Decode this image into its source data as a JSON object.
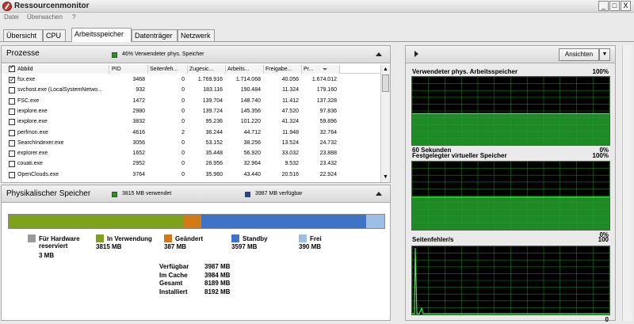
{
  "window": {
    "title": "Ressourcenmonitor",
    "controls": [
      "_",
      "□",
      "X"
    ]
  },
  "menu": [
    "Datei",
    "Überwachen",
    "?"
  ],
  "tabs": [
    {
      "label": "Übersicht",
      "active": false
    },
    {
      "label": "CPU",
      "active": false
    },
    {
      "label": "Arbeitsspeicher",
      "active": true
    },
    {
      "label": "Datenträger",
      "active": false
    },
    {
      "label": "Netzwerk",
      "active": false
    }
  ],
  "processes": {
    "title": "Prozesse",
    "usage_label": "46% Verwendeter phys. Speicher",
    "usage_color": "#1a9a1a",
    "columns": [
      "Abbild",
      "PID",
      "Seitenfeh...",
      "Zugesic...",
      "Arbeits...",
      "Freigabe...",
      "Pr..."
    ],
    "rows": [
      {
        "checked": true,
        "name": "fsx.exe",
        "pid": "3468",
        "faults": "0",
        "commit": "1.769.916",
        "working": "1.714.068",
        "shareable": "40.056",
        "private": "1.674.012"
      },
      {
        "checked": false,
        "name": "svchost.exe (LocalSystemNetwo...",
        "pid": "932",
        "faults": "0",
        "commit": "183.116",
        "working": "190.484",
        "shareable": "11.324",
        "private": "179.160"
      },
      {
        "checked": false,
        "name": "FSC.exe",
        "pid": "1472",
        "faults": "0",
        "commit": "139.704",
        "working": "148.740",
        "shareable": "11.412",
        "private": "137.328"
      },
      {
        "checked": false,
        "name": "iexplore.exe",
        "pid": "2980",
        "faults": "0",
        "commit": "139.724",
        "working": "145.356",
        "shareable": "47.520",
        "private": "97.836"
      },
      {
        "checked": false,
        "name": "iexplore.exe",
        "pid": "3832",
        "faults": "0",
        "commit": "95.236",
        "working": "101.220",
        "shareable": "41.324",
        "private": "59.896"
      },
      {
        "checked": false,
        "name": "perfmon.exe",
        "pid": "4616",
        "faults": "2",
        "commit": "36.244",
        "working": "44.712",
        "shareable": "11.948",
        "private": "32.764"
      },
      {
        "checked": false,
        "name": "SearchIndexer.exe",
        "pid": "3056",
        "faults": "0",
        "commit": "53.152",
        "working": "38.256",
        "shareable": "13.524",
        "private": "24.732"
      },
      {
        "checked": false,
        "name": "explorer.exe",
        "pid": "1652",
        "faults": "0",
        "commit": "35.448",
        "working": "56.920",
        "shareable": "33.032",
        "private": "23.888"
      },
      {
        "checked": false,
        "name": "couati.exe",
        "pid": "2952",
        "faults": "0",
        "commit": "26.956",
        "working": "32.964",
        "shareable": "9.532",
        "private": "23.432"
      },
      {
        "checked": false,
        "name": "OpenClouds.exe",
        "pid": "3764",
        "faults": "0",
        "commit": "35.960",
        "working": "43.440",
        "shareable": "20.516",
        "private": "22.924"
      }
    ]
  },
  "physical": {
    "title": "Physikalischer Speicher",
    "used_label": "3815 MB verwendet",
    "used_color": "#1a9a1a",
    "avail_label": "3987 MB verfügbar",
    "avail_color": "#1e3fb0",
    "bar": [
      {
        "mb": 3815,
        "color": "#7fa21c"
      },
      {
        "mb": 387,
        "color": "#d27b16"
      },
      {
        "mb": 3597,
        "color": "#3d74c7"
      },
      {
        "mb": 390,
        "color": "#9dbee6"
      }
    ],
    "legend": [
      {
        "label": "Für Hardware reserviert",
        "value": "3 MB",
        "color": "#9a9a9a"
      },
      {
        "label": "In Verwendung",
        "value": "3815 MB",
        "color": "#7fa21c"
      },
      {
        "label": "Geändert",
        "value": "387 MB",
        "color": "#d27b16"
      },
      {
        "label": "Standby",
        "value": "3597 MB",
        "color": "#3d74c7"
      },
      {
        "label": "Frei",
        "value": "390 MB",
        "color": "#9dbee6"
      }
    ],
    "stats": [
      {
        "label": "Verfügbar",
        "value": "3987 MB"
      },
      {
        "label": "Im Cache",
        "value": "3984 MB"
      },
      {
        "label": "Gesamt",
        "value": "8189 MB"
      },
      {
        "label": "Installiert",
        "value": "8192 MB"
      }
    ]
  },
  "right": {
    "view_button": "Ansichten",
    "graphs": [
      {
        "title": "Verwendeter phys. Arbeitsspeicher",
        "max": "100%",
        "footer_left": "60 Sekunden",
        "footer_right": "0%",
        "level": 0.46
      },
      {
        "title": "Festgelegter virtueller Speicher",
        "max": "100%",
        "footer_left": "",
        "footer_right": "0%",
        "level": 0.48
      },
      {
        "title": "Seitenfehler/s",
        "max": "100",
        "footer_left": "",
        "footer_right": "0",
        "level": 0.0
      }
    ]
  }
}
